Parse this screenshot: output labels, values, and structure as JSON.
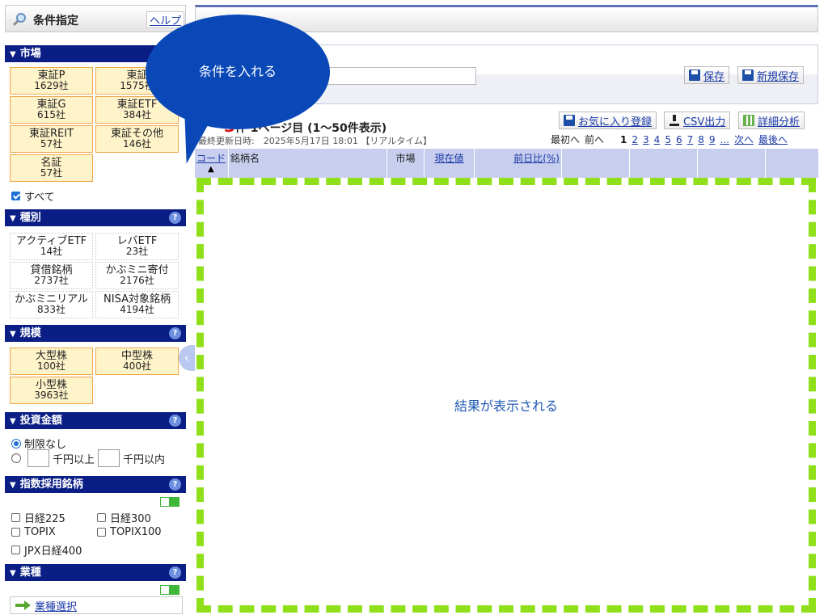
{
  "sidebar": {
    "title": "条件指定",
    "help": "ヘルプ",
    "market": {
      "heading": "市場",
      "buttons": [
        {
          "label": "東証P",
          "count": "1629社"
        },
        {
          "label": "東証",
          "count": "1575社"
        },
        {
          "label": "東証G",
          "count": "615社"
        },
        {
          "label": "東証ETF",
          "count": "384社"
        },
        {
          "label": "東証REIT",
          "count": "57社"
        },
        {
          "label": "東証その他",
          "count": "146社"
        },
        {
          "label": "名証",
          "count": "57社"
        }
      ],
      "all_label": "すべて"
    },
    "category": {
      "heading": "種別",
      "buttons": [
        {
          "label": "アクティブETF",
          "count": "14社"
        },
        {
          "label": "レバETF",
          "count": "23社"
        },
        {
          "label": "貸借銘柄",
          "count": "2737社"
        },
        {
          "label": "かぶミニ寄付",
          "count": "2176社"
        },
        {
          "label": "かぶミニリアル",
          "count": "833社"
        },
        {
          "label": "NISA対象銘柄",
          "count": "4194社"
        }
      ]
    },
    "scale": {
      "heading": "規模",
      "buttons": [
        {
          "label": "大型株",
          "count": "100社"
        },
        {
          "label": "中型株",
          "count": "400社"
        },
        {
          "label": "小型株",
          "count": "3963社"
        }
      ]
    },
    "investment": {
      "heading": "投資金額",
      "no_limit": "制限なし",
      "above": "千円以上",
      "within": "千円以内"
    },
    "index": {
      "heading": "指数採用銘柄",
      "items": [
        "日経225",
        "日経300",
        "TOPIX",
        "TOPIX100",
        "JPX日経400"
      ]
    },
    "industry": {
      "heading": "業種",
      "select_label": "業種選択"
    }
  },
  "main": {
    "save_label": "保存",
    "new_save_label": "新規保存",
    "result_count": "3",
    "result_suffix": "件",
    "page_info": "1ページ目 (1〜50件表示)",
    "updated": "最終更新日時:　2025年5月17日 18:01 【リアルタイム】",
    "favorite_label": "お気に入り登録",
    "csv_label": "CSV出力",
    "analysis_label": "詳細分析",
    "pager": {
      "first": "最初へ",
      "prev": "前へ",
      "pages": [
        "1",
        "2",
        "3",
        "4",
        "5",
        "6",
        "7",
        "8",
        "9"
      ],
      "ellipsis": "...",
      "next": "次へ",
      "last": "最後へ"
    },
    "columns": {
      "code": "コード",
      "name": "銘柄名",
      "market": "市場",
      "price": "現在値",
      "change": "前日比(%)"
    },
    "result_placeholder": "結果が表示される"
  },
  "callout": {
    "text": "条件を入れる"
  },
  "colors": {
    "accent": "#0b1e85",
    "callout": "#0a48b8",
    "highlight_border": "#8fe01a"
  }
}
